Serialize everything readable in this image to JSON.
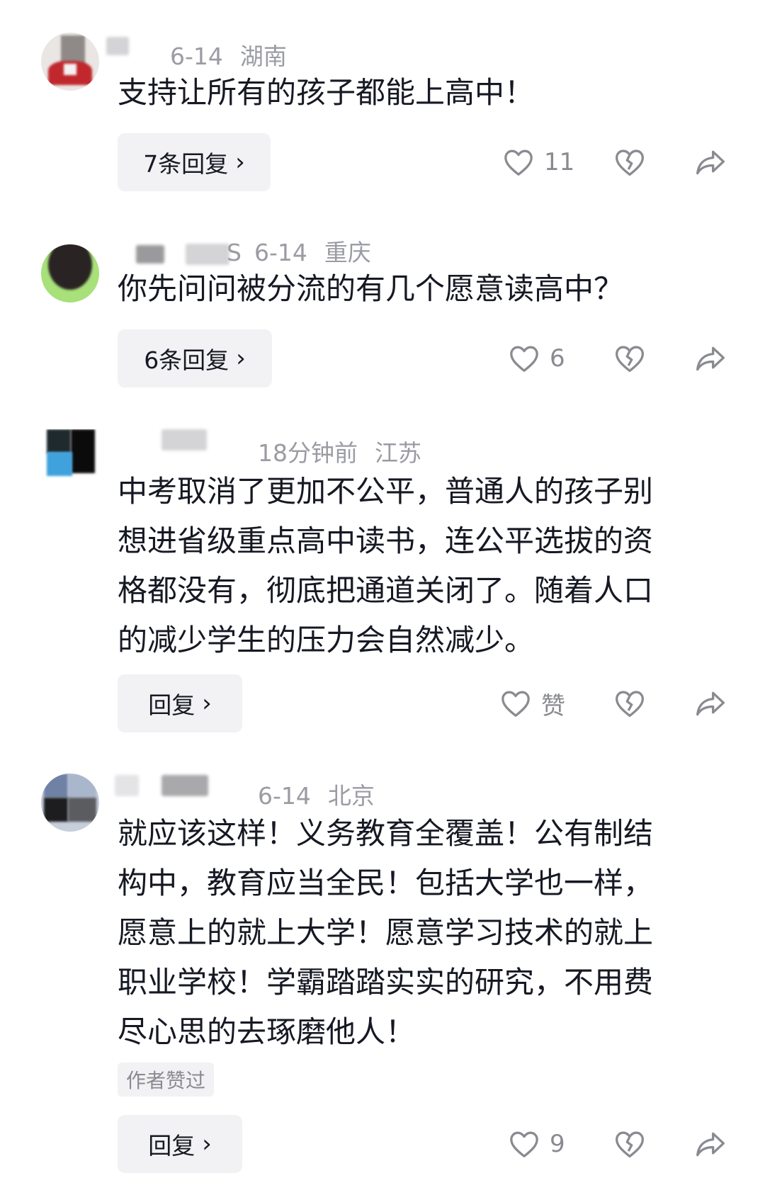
{
  "comments": [
    {
      "date": "6-14",
      "location": "湖南",
      "lines": [
        "支持让所有的孩子都能上高中！"
      ],
      "reply_button": "7条回复",
      "likes": "11"
    },
    {
      "name_fragment": "S",
      "date": "6-14",
      "location": "重庆",
      "lines": [
        "你先问问被分流的有几个愿意读高中？"
      ],
      "reply_button": "6条回复",
      "likes": "6"
    },
    {
      "date": "18分钟前",
      "location": "江苏",
      "lines": [
        "中考取消了更加不公平，普通人的孩子别",
        "想进省级重点高中读书，连公平选拔的资",
        "格都没有，彻底把通道关闭了。随着人口",
        "的减少学生的压力会自然减少。"
      ],
      "reply_button": "回复",
      "likes": "赞"
    },
    {
      "date": "6-14",
      "location": "北京",
      "lines": [
        "就应该这样！义务教育全覆盖！公有制结",
        "构中，教育应当全民！包括大学也一样，",
        "愿意上的就上大学！愿意学习技术的就上",
        "职业学校！学霸踏踏实实的研究，不用费",
        "尽心思的去琢磨他人！"
      ],
      "author_liked_tag": "作者赞过",
      "reply_button": "回复",
      "likes": "9"
    }
  ],
  "icons": {
    "chevron": "›",
    "like": "heart-outline-icon",
    "dislike": "broken-heart-icon",
    "share": "share-arrow-icon"
  },
  "colors": {
    "text": "#161823",
    "meta": "#9b9ca3",
    "pill_bg": "#f2f2f4"
  }
}
